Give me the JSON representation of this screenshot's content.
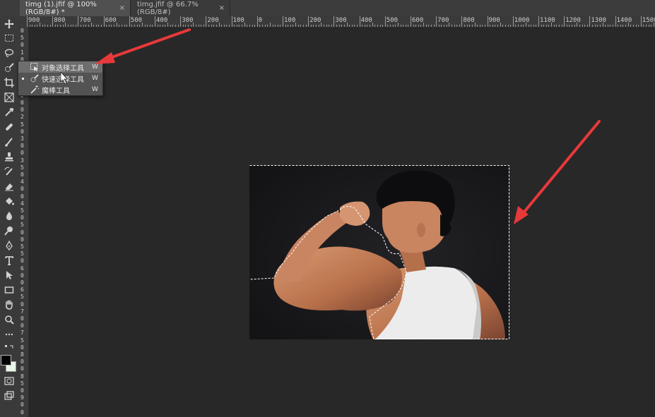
{
  "tabs": [
    {
      "label": "timg (1).jfif @ 100%(RGB/8#) *",
      "close": "×",
      "active": true
    },
    {
      "label": "timg.jfif @ 66.7%(RGB/8#)",
      "close": "×",
      "active": false
    }
  ],
  "ruler_h": [
    "900",
    "800",
    "700",
    "600",
    "500",
    "400",
    "300",
    "200",
    "100",
    "0",
    "100",
    "200",
    "300",
    "400",
    "500",
    "600",
    "700",
    "800",
    "900",
    "1000",
    "1100",
    "1200",
    "1300",
    "1400",
    "1500"
  ],
  "ruler_v": [
    "0",
    "5",
    "0",
    "1",
    "0",
    "0",
    "1",
    "5",
    "0",
    "2",
    "0",
    "0",
    "2",
    "5",
    "0",
    "3",
    "0",
    "0",
    "3",
    "5",
    "0",
    "4",
    "0",
    "0",
    "4",
    "5",
    "0",
    "5",
    "0",
    "0",
    "5",
    "5",
    "0",
    "6",
    "0",
    "0",
    "6",
    "5",
    "0",
    "7",
    "0",
    "0",
    "7",
    "5",
    "0",
    "8",
    "0",
    "0",
    "8",
    "5",
    "0",
    "9",
    "0",
    "0"
  ],
  "flyout": [
    {
      "label": "对象选择工具",
      "shortcut": "W",
      "icon": "object-selection-icon"
    },
    {
      "label": "快速选择工具",
      "shortcut": "W",
      "icon": "quick-selection-icon"
    },
    {
      "label": "魔棒工具",
      "shortcut": "W",
      "icon": "magic-wand-icon"
    }
  ],
  "tools": [
    "move-icon",
    "marquee-icon",
    "lasso-icon",
    "quick-selection-icon",
    "crop-icon",
    "frame-icon",
    "eyedropper-icon",
    "healing-icon",
    "brush-icon",
    "stamp-icon",
    "history-brush-icon",
    "eraser-icon",
    "paint-bucket-icon",
    "blur-icon",
    "dodge-icon",
    "pen-icon",
    "type-icon",
    "path-selection-icon",
    "rectangle-icon",
    "hand-icon",
    "zoom-icon",
    "more-icon"
  ],
  "colors": {
    "foreground": "#000000",
    "background": "#e8f5e8",
    "accent_arrow": "#e8393a"
  }
}
